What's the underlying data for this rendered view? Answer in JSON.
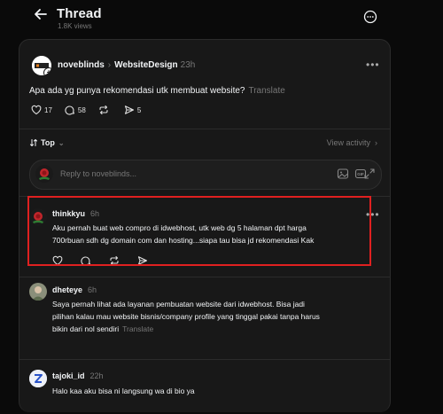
{
  "header": {
    "title": "Thread",
    "views": "1.8K views"
  },
  "post": {
    "author": "noveblinds",
    "community": "WebsiteDesign",
    "time": "23h",
    "text": "Apa ada yg punya rekomendasi utk membuat website?",
    "translate": "Translate",
    "likes": "17",
    "comments": "58",
    "shares": "5"
  },
  "sort": {
    "label": "Top",
    "view_activity": "View activity"
  },
  "reply": {
    "placeholder": "Reply to noveblinds..."
  },
  "comments": [
    {
      "author": "thinkkyu",
      "time": "6h",
      "line1": "Aku pernah buat web compro di idwebhost, utk web dg 5 halaman dpt harga",
      "line2": "700rbuan sdh dg domain com dan hosting...siapa tau bisa jd rekomendasi Kak"
    },
    {
      "author": "dheteye",
      "time": "6h",
      "line1": "Saya pernah lihat ada layanan pembuatan website dari idwebhost. Bisa jadi",
      "line2": "pilihan kalau mau website bisnis/company profile yang tinggal pakai tanpa harus",
      "line3": "bikin dari nol sendiri",
      "translate": "Translate"
    },
    {
      "author": "tajoki_id",
      "time": "22h",
      "line1": "Halo kaa aku bisa ni langsung wa di bio ya"
    }
  ],
  "colors": {
    "background": "#0a0a0a",
    "panel": "#181818",
    "highlight": "#e02020",
    "muted": "#777777"
  }
}
